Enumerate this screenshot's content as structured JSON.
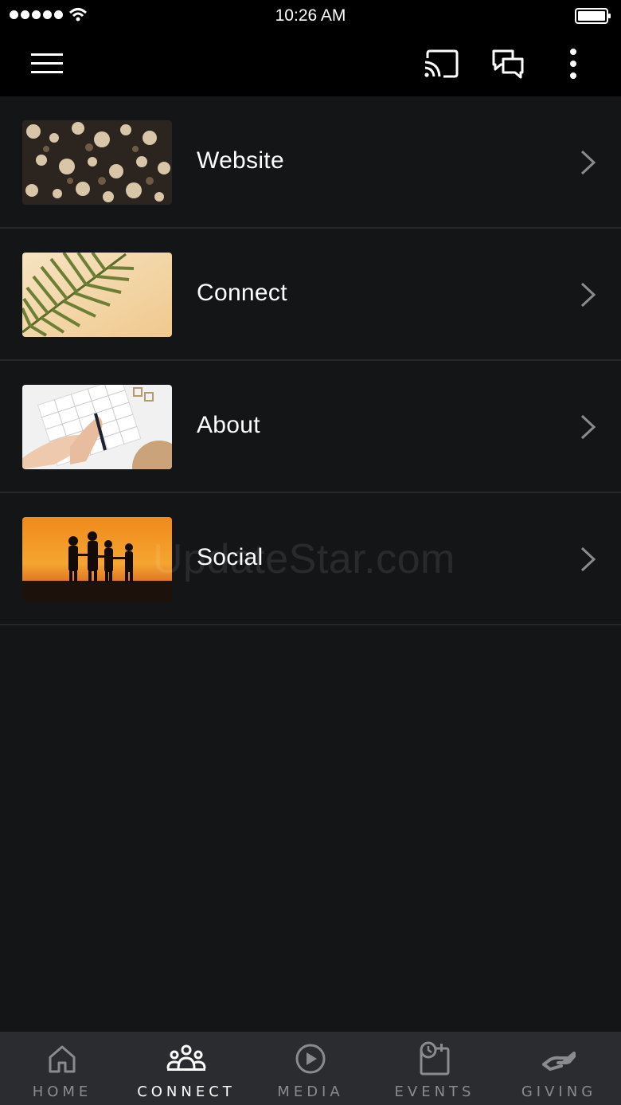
{
  "status_bar": {
    "time": "10:26 AM",
    "signal_icon": "signal-dots-icon",
    "wifi_icon": "wifi-icon",
    "battery_icon": "battery-icon"
  },
  "app_bar": {
    "menu_icon": "hamburger-menu-icon",
    "cast_icon": "cast-icon",
    "chat_icon": "chat-bubbles-icon",
    "more_icon": "more-vertical-icon"
  },
  "list": {
    "items": [
      {
        "label": "Website",
        "thumbnail": "logs-pile-image"
      },
      {
        "label": "Connect",
        "thumbnail": "palm-leaf-image"
      },
      {
        "label": "About",
        "thumbnail": "hands-writing-image"
      },
      {
        "label": "Social",
        "thumbnail": "sunset-silhouettes-image"
      }
    ]
  },
  "watermark": "UpdateStar.com",
  "tab_bar": {
    "active": "CONNECT",
    "tabs": [
      {
        "label": "HOME",
        "icon": "home-icon"
      },
      {
        "label": "CONNECT",
        "icon": "people-group-icon"
      },
      {
        "label": "MEDIA",
        "icon": "play-circle-icon"
      },
      {
        "label": "EVENTS",
        "icon": "calendar-clock-icon"
      },
      {
        "label": "GIVING",
        "icon": "giving-hand-icon"
      }
    ]
  },
  "colors": {
    "background": "#141517",
    "app_bar": "#000000",
    "tab_bar": "#2b2c2f",
    "tab_inactive": "#8a8b8e",
    "tab_active": "#ffffff",
    "divider": "#25272b"
  }
}
